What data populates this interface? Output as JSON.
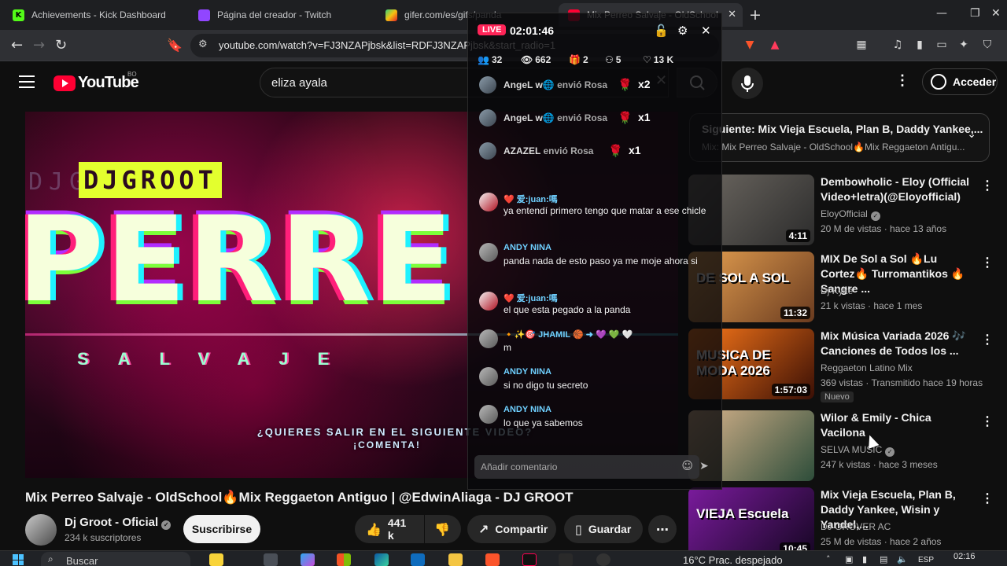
{
  "browser": {
    "tabs": [
      {
        "label": "Achievements - Kick Dashboard",
        "favicon": "K"
      },
      {
        "label": "Página del creador - Twitch",
        "favicon": "twitch-logo"
      },
      {
        "label": "gifer.com/es/gifs/panda",
        "favicon": "gifer-logo"
      },
      {
        "label": "Mix Perreo Salvaje - OldSchool",
        "favicon": "youtube-logo"
      }
    ],
    "url": "youtube.com/watch?v=FJ3NZAPjbsk&list=RDFJ3NZAPjbsk&start_radio=1"
  },
  "youtube": {
    "logo_text": "YouTube",
    "country": "BO",
    "search_value": "eliza ayala",
    "login_label": "Acceder",
    "video": {
      "title": "Mix Perreo Salvaje - OldSchool🔥Mix Reggaeton Antiguo | @EdwinAliaga - DJ GROOT",
      "thumbnail_brand": "DJGROOT",
      "thumbnail_brand_ghost": "DJGROOT",
      "thumbnail_word": "PERRE",
      "thumbnail_sub": "SALVAJE",
      "cta_line1": "¿QUIERES SALIR EN EL SIGUIENTE VIDEO?",
      "cta_line2": "¡COMENTA!",
      "channel": "Dj Groot - Oficial",
      "subscribers": "234 k suscriptores",
      "subscribe": "Suscribirse",
      "likes": "441 k",
      "share": "Compartir",
      "save": "Guardar"
    },
    "up_next": {
      "title": "Siguiente: Mix Vieja Escuela, Plan B, Daddy Yankee,...",
      "subtitle": "Mix: Mix Perreo Salvaje - OldSchool🔥Mix Reggaeton Antigu..."
    },
    "recommendations": [
      {
        "title": "Dembowholic - Eloy (Official Video+letra)(@Eloyofficial)",
        "channel": "EloyOfficial",
        "verified": true,
        "meta": "20 M de vistas · hace 13 años",
        "duration": "4:11",
        "thumb_text": "",
        "thumb_colors": [
          "#6f6a63",
          "#2b2b2b"
        ]
      },
      {
        "title": "MIX De Sol a Sol 🔥Lu Cortez🔥 Turromantikos 🔥 Sangre ...",
        "channel": "Dj Kyke",
        "verified": false,
        "meta": "21 k vistas · hace 1 mes",
        "duration": "11:32",
        "thumb_text": "DE SOL A SOL",
        "thumb_colors": [
          "#e9a352",
          "#6a3b1f"
        ]
      },
      {
        "title": "Mix Música Variada 2026 🎶 Canciones de Todos los ...",
        "channel": "Reggaeton Latino Mix",
        "verified": false,
        "meta": "369 vistas · Transmitido hace 19 horas",
        "duration": "1:57:03",
        "badge": "Nuevo",
        "thumb_text": "MUSICA DE MODA 2026",
        "thumb_colors": [
          "#ff7a1a",
          "#3a0f05"
        ]
      },
      {
        "title": "Wilor & Emily - Chica Vacilona",
        "channel": "SELVA MUSIC",
        "verified": true,
        "meta": "247 k vistas · hace 3 meses",
        "duration": "",
        "thumb_text": "",
        "thumb_colors": [
          "#dcb68e",
          "#2d4d3a"
        ]
      },
      {
        "title": "Mix Vieja Escuela, Plan B, Daddy Yankee, Wisin y Yandel,...",
        "channel": "DJ GROVER AC",
        "verified": false,
        "meta": "25 M de vistas · hace 2 años",
        "duration": "10:45",
        "thumb_text": "VIEJA Escuela",
        "thumb_colors": [
          "#7a1b9c",
          "#150622"
        ]
      }
    ]
  },
  "live_chat": {
    "live_label": "LIVE",
    "timer": "02:01:46",
    "stats": {
      "viewers": "32",
      "views": "662",
      "gifts": "2",
      "shares": "5",
      "likes": "13 K"
    },
    "gifts": [
      {
        "user": "AngeL w🌐",
        "action": "envió Rosa",
        "count": "x2"
      },
      {
        "user": "AngeL w🌐",
        "action": "envió Rosa",
        "count": "x1"
      },
      {
        "user": "AZAZEL",
        "action": "envió Rosa",
        "count": "x1"
      }
    ],
    "messages": [
      {
        "user": "❤️ 爱:juan:嗎",
        "text": "ya entendí primero tengo que matar a ese chicle"
      },
      {
        "user": "ANDY NINA",
        "text": "panda nada de esto paso ya me moje ahora si"
      },
      {
        "user": "❤️ 爱:juan:嗎",
        "text": "el que esta pegado a la panda"
      },
      {
        "user": "🔸✨🎯 JHAMIL 🏀 ➜ 💜 💚 🤍",
        "text": "m"
      },
      {
        "user": "ANDY NINA",
        "text": "si no digo tu secreto"
      },
      {
        "user": "ANDY NINA",
        "text": "lo que ya sabemos"
      }
    ],
    "input_placeholder": "Añadir comentario"
  },
  "taskbar": {
    "search": "Buscar",
    "weather": "16°C  Prac. despejado",
    "lang": "ESP",
    "time": "02:16"
  },
  "colors": {
    "yt_red": "#ff0033",
    "live_red": "#ff2457",
    "chat_user": "#6fd0ff",
    "background": "#0f0f0f"
  }
}
